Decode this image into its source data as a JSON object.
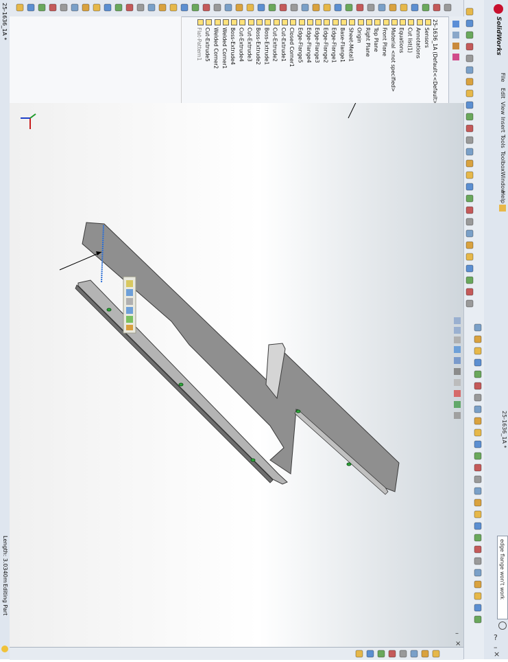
{
  "window": {
    "app_name": "SolidWorks",
    "document_title": "25-1636_1A *"
  },
  "menubar": [
    "File",
    "Edit",
    "View",
    "Insert",
    "Tools",
    "Toolbox",
    "Window",
    "Help"
  ],
  "search": {
    "value": "edge flange won't work"
  },
  "feature_tree": {
    "root": "25-1636_1A (Default<<Default>_D",
    "items": [
      {
        "label": "Sensors",
        "dim": false
      },
      {
        "label": "Annotations",
        "dim": false
      },
      {
        "label": "Cut list(1)",
        "dim": false
      },
      {
        "label": "Equations",
        "dim": false
      },
      {
        "label": "Material <not specified>",
        "dim": false
      },
      {
        "label": "Front Plane",
        "dim": false
      },
      {
        "label": "Top Plane",
        "dim": false
      },
      {
        "label": "Right Plane",
        "dim": false
      },
      {
        "label": "Origin",
        "dim": false
      },
      {
        "label": "Sheet-Metal1",
        "dim": false
      },
      {
        "label": "Base-Flange1",
        "dim": false
      },
      {
        "label": "Edge-Flange1",
        "dim": false
      },
      {
        "label": "Edge-Flange2",
        "dim": false
      },
      {
        "label": "Edge-Flange3",
        "dim": false
      },
      {
        "label": "Edge-Flange4",
        "dim": false
      },
      {
        "label": "Edge-Flange5",
        "dim": false
      },
      {
        "label": "Closed Corner1",
        "dim": false
      },
      {
        "label": "Cut-Extrude1",
        "dim": false
      },
      {
        "label": "Cut-Extrude2",
        "dim": false
      },
      {
        "label": "Boss-Extrude1",
        "dim": false
      },
      {
        "label": "Boss-Extrude2",
        "dim": false
      },
      {
        "label": "Cut-Extrude3",
        "dim": false
      },
      {
        "label": "Cut-Extrude4",
        "dim": false
      },
      {
        "label": "Boss-Extrude4",
        "dim": false
      },
      {
        "label": "Welded Corner1",
        "dim": false
      },
      {
        "label": "Welded Corner2",
        "dim": false
      },
      {
        "label": "Cut-Extrude5",
        "dim": false
      },
      {
        "label": "Flat-Pattern1",
        "dim": true
      }
    ]
  },
  "status": {
    "length": "Length: 3.0340m",
    "mode": "Editing Part"
  },
  "colors": {
    "part_face": "#8c8c8c",
    "part_edge": "#3a3a3a",
    "hole": "#2fa83a",
    "selected_edge": "#2c6fd6"
  },
  "icons": {
    "logo": "solidworks-logo-icon",
    "orientation": "triad-icon"
  }
}
